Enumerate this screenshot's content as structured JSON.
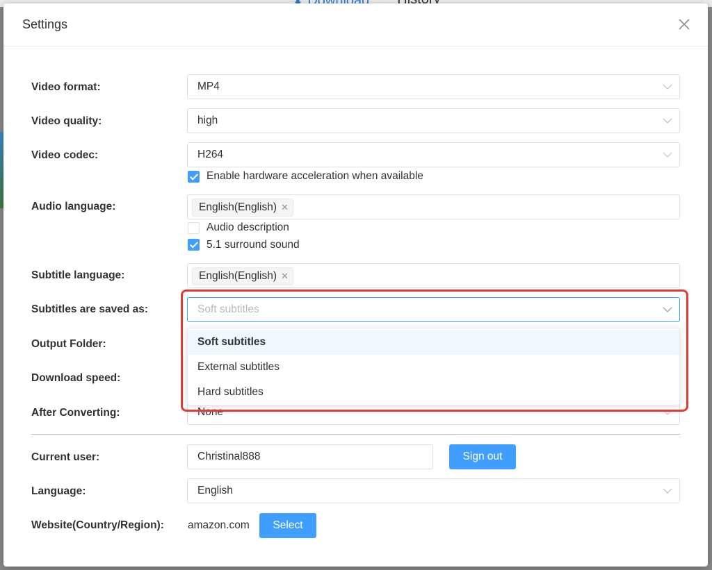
{
  "background": {
    "tab_download": "⬇ Download",
    "tab_history": "History"
  },
  "dialog": {
    "title": "Settings",
    "close_icon": "close-icon"
  },
  "fields": {
    "video_format": {
      "label": "Video format:",
      "value": "MP4"
    },
    "video_quality": {
      "label": "Video quality:",
      "value": "high"
    },
    "video_codec": {
      "label": "Video codec:",
      "value": "H264"
    },
    "hw_accel": {
      "label": "Enable hardware acceleration when available",
      "checked": true
    },
    "audio_language": {
      "label": "Audio language:",
      "tag": "English(English)"
    },
    "audio_description": {
      "label": "Audio description",
      "checked": false
    },
    "surround_sound": {
      "label": "5.1 surround sound",
      "checked": true
    },
    "subtitle_language": {
      "label": "Subtitle language:",
      "tag": "English(English)"
    },
    "subtitles_saved_as": {
      "label": "Subtitles are saved as:",
      "placeholder": "Soft subtitles",
      "options": [
        "Soft subtitles",
        "External subtitles",
        "Hard subtitles"
      ],
      "selected": "Soft subtitles"
    },
    "output_folder": {
      "label": "Output Folder:"
    },
    "download_speed": {
      "label": "Download speed:"
    },
    "after_converting": {
      "label": "After Converting:",
      "value": "None"
    },
    "current_user": {
      "label": "Current user:",
      "value": "Christinal888",
      "button": "Sign out"
    },
    "language": {
      "label": "Language:",
      "value": "English"
    },
    "website": {
      "label": "Website(Country/Region):",
      "value": "amazon.com",
      "button": "Select"
    }
  },
  "colors": {
    "accent": "#409eff",
    "highlight_border": "#e53a2f"
  }
}
